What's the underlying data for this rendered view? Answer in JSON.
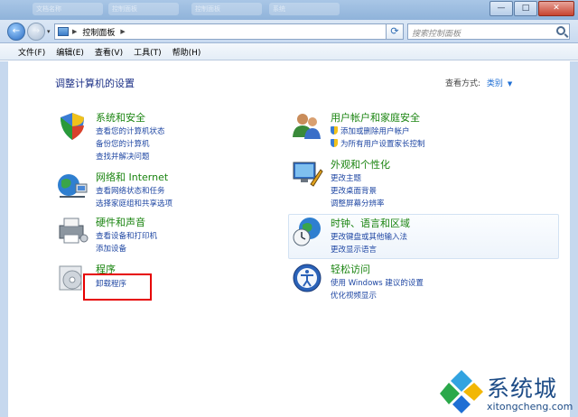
{
  "window": {
    "ghost_tabs": [
      "文档名称",
      "控制面板",
      "系统",
      "控制面板"
    ],
    "controls": {
      "minimize": "—",
      "maximize": "□",
      "close": "✕"
    }
  },
  "addressbar": {
    "back": "←",
    "forward": "→",
    "breadcrumb": [
      "控制面板"
    ],
    "sep": "▶",
    "search_placeholder": "搜索控制面板"
  },
  "menubar": [
    "文件(F)",
    "编辑(E)",
    "查看(V)",
    "工具(T)",
    "帮助(H)"
  ],
  "page": {
    "title": "调整计算机的设置",
    "viewby_label": "查看方式:",
    "viewby_value": "类别",
    "viewby_arrow": "▼"
  },
  "categories": [
    {
      "title": "系统和安全",
      "icon": "shield-icon",
      "links": [
        "查看您的计算机状态",
        "备份您的计算机",
        "查找并解决问题"
      ]
    },
    {
      "title": "网络和 Internet",
      "icon": "network-globe-icon",
      "links": [
        "查看网络状态和任务",
        "选择家庭组和共享选项"
      ]
    },
    {
      "title": "硬件和声音",
      "icon": "printer-icon",
      "links": [
        "查看设备和打印机",
        "添加设备"
      ]
    },
    {
      "title": "程序",
      "icon": "programs-icon",
      "links": [
        "卸载程序"
      ]
    },
    {
      "title": "用户帐户和家庭安全",
      "icon": "users-icon",
      "links": [
        "添加或删除用户帐户",
        "为所有用户设置家长控制"
      ]
    },
    {
      "title": "外观和个性化",
      "icon": "appearance-icon",
      "links": [
        "更改主题",
        "更改桌面背景",
        "调整屏幕分辨率"
      ]
    },
    {
      "title": "时钟、语言和区域",
      "icon": "clock-globe-icon",
      "links": [
        "更改键盘或其他输入法",
        "更改显示语言"
      ]
    },
    {
      "title": "轻松访问",
      "icon": "ease-of-access-icon",
      "links": [
        "使用 Windows 建议的设置",
        "优化视频显示"
      ]
    }
  ],
  "watermark": {
    "text": "系统城",
    "url": "xitongcheng.com"
  },
  "colors": {
    "heading_green": "#1a8410",
    "link_blue": "#1f47a3",
    "highlight_red": "#e60000"
  }
}
